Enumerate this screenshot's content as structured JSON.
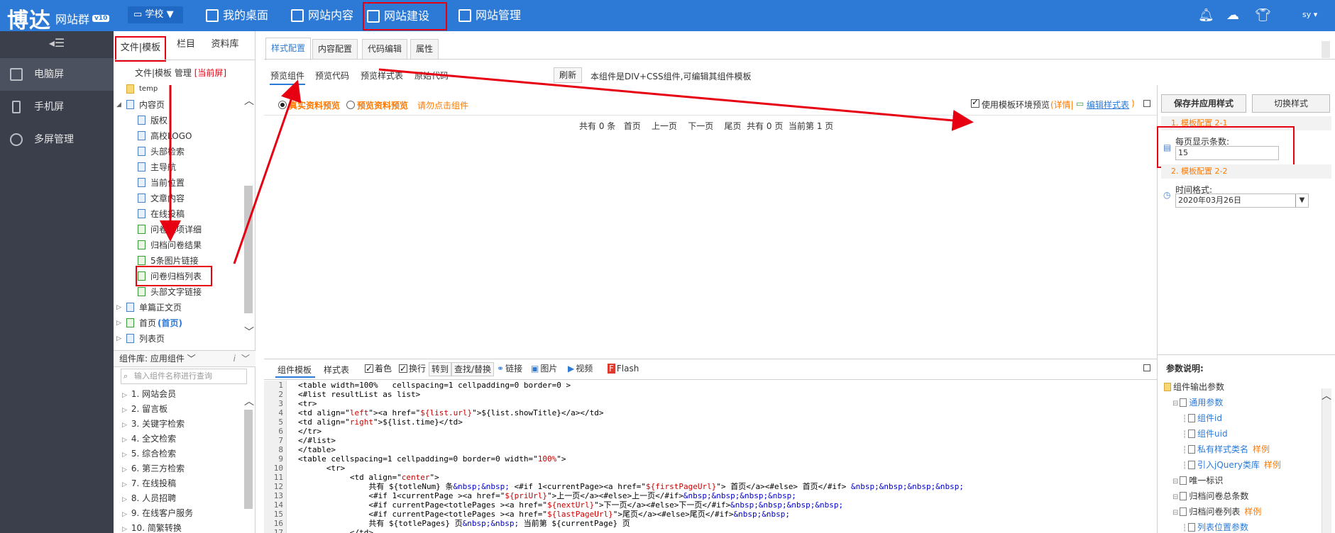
{
  "topbar": {
    "logo": "博达",
    "logo_sub": "网站群",
    "version": "v10",
    "school_label": "学校",
    "nav": [
      {
        "label": "我的桌面",
        "icon": "grid-icon"
      },
      {
        "label": "网站内容",
        "icon": "edit-icon"
      },
      {
        "label": "网站建设",
        "icon": "build-icon"
      },
      {
        "label": "网站管理",
        "icon": "monitor-gear-icon"
      }
    ],
    "right_icons": [
      "bell-icon",
      "cloud-icon",
      "shirt-icon"
    ],
    "user": "sy ▾"
  },
  "sidebar": {
    "collapse": "◂☰",
    "items": [
      {
        "label": "电脑屏",
        "icon": "monitor-icon"
      },
      {
        "label": "手机屏",
        "icon": "phone-icon"
      },
      {
        "label": "多屏管理",
        "icon": "multi-screen-icon"
      }
    ]
  },
  "tree": {
    "tabs": [
      "文件|模板",
      "栏目",
      "资料库"
    ],
    "sub_label": "文件|模板 管理",
    "sub_current": "[当前屏]",
    "rows": [
      {
        "label": "temp",
        "level": 0,
        "type": "folder"
      },
      {
        "label": "内容页",
        "level": 0,
        "type": "page",
        "arrow": "◢"
      },
      {
        "label": "版权",
        "level": 1,
        "type": "page"
      },
      {
        "label": "高校LOGO",
        "level": 1,
        "type": "page"
      },
      {
        "label": "头部检索",
        "level": 1,
        "type": "page"
      },
      {
        "label": "主导航",
        "level": 1,
        "type": "page"
      },
      {
        "label": "当前位置",
        "level": 1,
        "type": "page"
      },
      {
        "label": "文章内容",
        "level": 1,
        "type": "page"
      },
      {
        "label": "在线投稿",
        "level": 1,
        "type": "page"
      },
      {
        "label": "问卷选项详细",
        "level": 1,
        "type": "green"
      },
      {
        "label": "归档问卷结果",
        "level": 1,
        "type": "green"
      },
      {
        "label": "5条图片链接",
        "level": 1,
        "type": "green"
      },
      {
        "label": "问卷归档列表",
        "level": 1,
        "type": "green"
      },
      {
        "label": "头部文字链接",
        "level": 1,
        "type": "green"
      },
      {
        "label": "单篇正文页",
        "level": 0,
        "type": "page",
        "arrow": "▷"
      },
      {
        "label": "首页",
        "level": 0,
        "type": "green",
        "arrow": "▷",
        "suffix": "(首页)"
      },
      {
        "label": "列表页",
        "level": 0,
        "type": "page",
        "arrow": "▷"
      }
    ]
  },
  "component_library": {
    "header": "组件库: 应用组件",
    "search_placeholder": "输入组件名称进行查询",
    "items": [
      "1. 网站会员",
      "2. 留言板",
      "3. 关键字检索",
      "4. 全文检索",
      "5. 综合检索",
      "6. 第三方检索",
      "7. 在线投稿",
      "8. 人员招聘",
      "9. 在线客户服务",
      "10. 简繁转换"
    ]
  },
  "main": {
    "tabs": [
      "样式配置",
      "内容配置",
      "代码编辑",
      "属性"
    ],
    "subtabs": [
      "预览组件",
      "预览代码",
      "预览样式表",
      "原始代码"
    ],
    "refresh": "刷新",
    "desc": "本组件是DIV+CSS组件,可编辑其组件模板",
    "preview": {
      "radio1": "真实资料预览",
      "radio2": "预览资料预览",
      "hint": "请勿点击组件",
      "env_check": "使用模板环境预览",
      "detail": "(详情|",
      "edit_style": "编辑样式表",
      "detail_end": ")"
    },
    "pager": "共有 0 条   首页    上一页    下一页    尾页  共有 0 页  当前第 1 页"
  },
  "right_panel": {
    "save_apply": "保存并应用样式",
    "switch_style": "切换样式",
    "section1": "1. 模板配置 2-1",
    "field1_label": "每页显示条数:",
    "field1_value": "15",
    "section2": "2. 模板配置 2-2",
    "field2_label": "时间格式:",
    "field2_value": "2020年03月26日"
  },
  "editor": {
    "tabs": [
      "组件模板",
      "样式表"
    ],
    "tools": [
      {
        "label": "着色",
        "type": "check",
        "on": true
      },
      {
        "label": "换行",
        "type": "check",
        "on": true
      },
      {
        "label": "转到",
        "type": "btn"
      },
      {
        "label": "查找/替换",
        "type": "btn"
      },
      {
        "label": "链接",
        "type": "icon"
      },
      {
        "label": "图片",
        "type": "icon"
      },
      {
        "label": "视频",
        "type": "icon"
      },
      {
        "label": "Flash",
        "type": "icon"
      }
    ],
    "lines": [
      "<table width=100%   cellspacing=1 cellpadding=0 border=0 >",
      "<#list resultList as list>",
      "<tr>",
      "<td align=\"left\"><a href=\"${list.url}\">${list.showTitle}</a></td>",
      "<td align=\"right\">${list.time}</td>",
      "</tr>",
      "</#list>",
      "</table>",
      "<table cellspacing=1 cellpadding=0 border=0 width=\"100%\">",
      "      <tr>",
      "           <td align=\"center\">",
      "               共有 ${totleNum} 条&nbsp;&nbsp; <#if 1<currentPage><a href=\"${firstPageUrl}\"> 首页</a><#else> 首页</#if> &nbsp;&nbsp;&nbsp;&nbsp;",
      "               <#if 1<currentPage ><a href=\"${priUrl}\">上一页</a><#else>上一页</#if>&nbsp;&nbsp;&nbsp;&nbsp;",
      "               <#if currentPage<totlePages ><a href=\"${nextUrl}\">下一页</a><#else>下一页</#if>&nbsp;&nbsp;&nbsp;&nbsp;",
      "               <#if currentPage<totlePages ><a href=\"${lastPageUrl}\">尾页</a><#else>尾页</#if>&nbsp;&nbsp;",
      "               共有 ${totlePages} 页&nbsp;&nbsp; 当前第 ${currentPage} 页",
      "           </td>"
    ]
  },
  "params": {
    "title": "参数说明:",
    "rows": [
      {
        "label": "组件输出参数",
        "indent": 0,
        "color": "#333"
      },
      {
        "label": "通用参数",
        "indent": 1,
        "color": "#2d7ad6"
      },
      {
        "label": "组件id",
        "indent": 2,
        "color": "#2d7ad6"
      },
      {
        "label": "组件uid",
        "indent": 2,
        "color": "#2d7ad6"
      },
      {
        "label": "私有样式类名",
        "indent": 2,
        "color": "#2d7ad6",
        "extra": "样例"
      },
      {
        "label": "引入jQuery类库",
        "indent": 2,
        "color": "#2d7ad6",
        "extra": "样例"
      },
      {
        "label": "唯一标识",
        "indent": 1,
        "color": "#333"
      },
      {
        "label": "归档问卷总条数",
        "indent": 1,
        "color": "#333"
      },
      {
        "label": "归档问卷列表",
        "indent": 1,
        "color": "#333",
        "extra": "样例"
      },
      {
        "label": "列表位置参数",
        "indent": 2,
        "color": "#2d7ad6"
      }
    ]
  }
}
